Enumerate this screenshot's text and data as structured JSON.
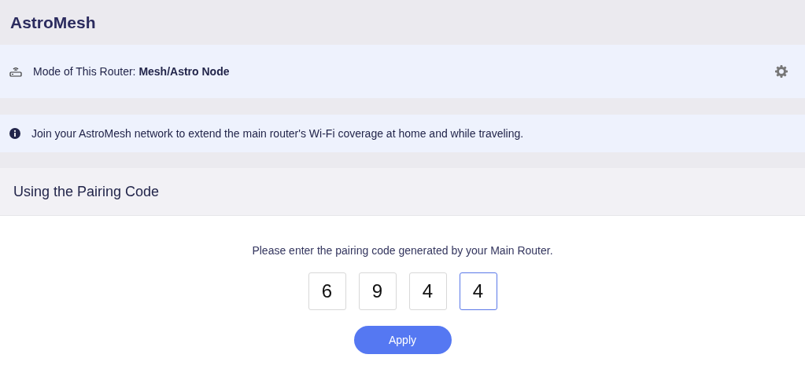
{
  "app_title": "AstroMesh",
  "mode": {
    "label": "Mode of This Router: ",
    "value": "Mesh/Astro Node"
  },
  "info": "Join your AstroMesh network to extend the main router's Wi-Fi coverage at home and while traveling.",
  "section": {
    "title": "Using the Pairing Code",
    "prompt": "Please enter the pairing code generated by your Main Router.",
    "digits": [
      {
        "value": "6",
        "selected": false
      },
      {
        "value": "9",
        "selected": false
      },
      {
        "value": "4",
        "selected": false
      },
      {
        "value": "4",
        "selected": true
      }
    ],
    "button": "Apply"
  }
}
